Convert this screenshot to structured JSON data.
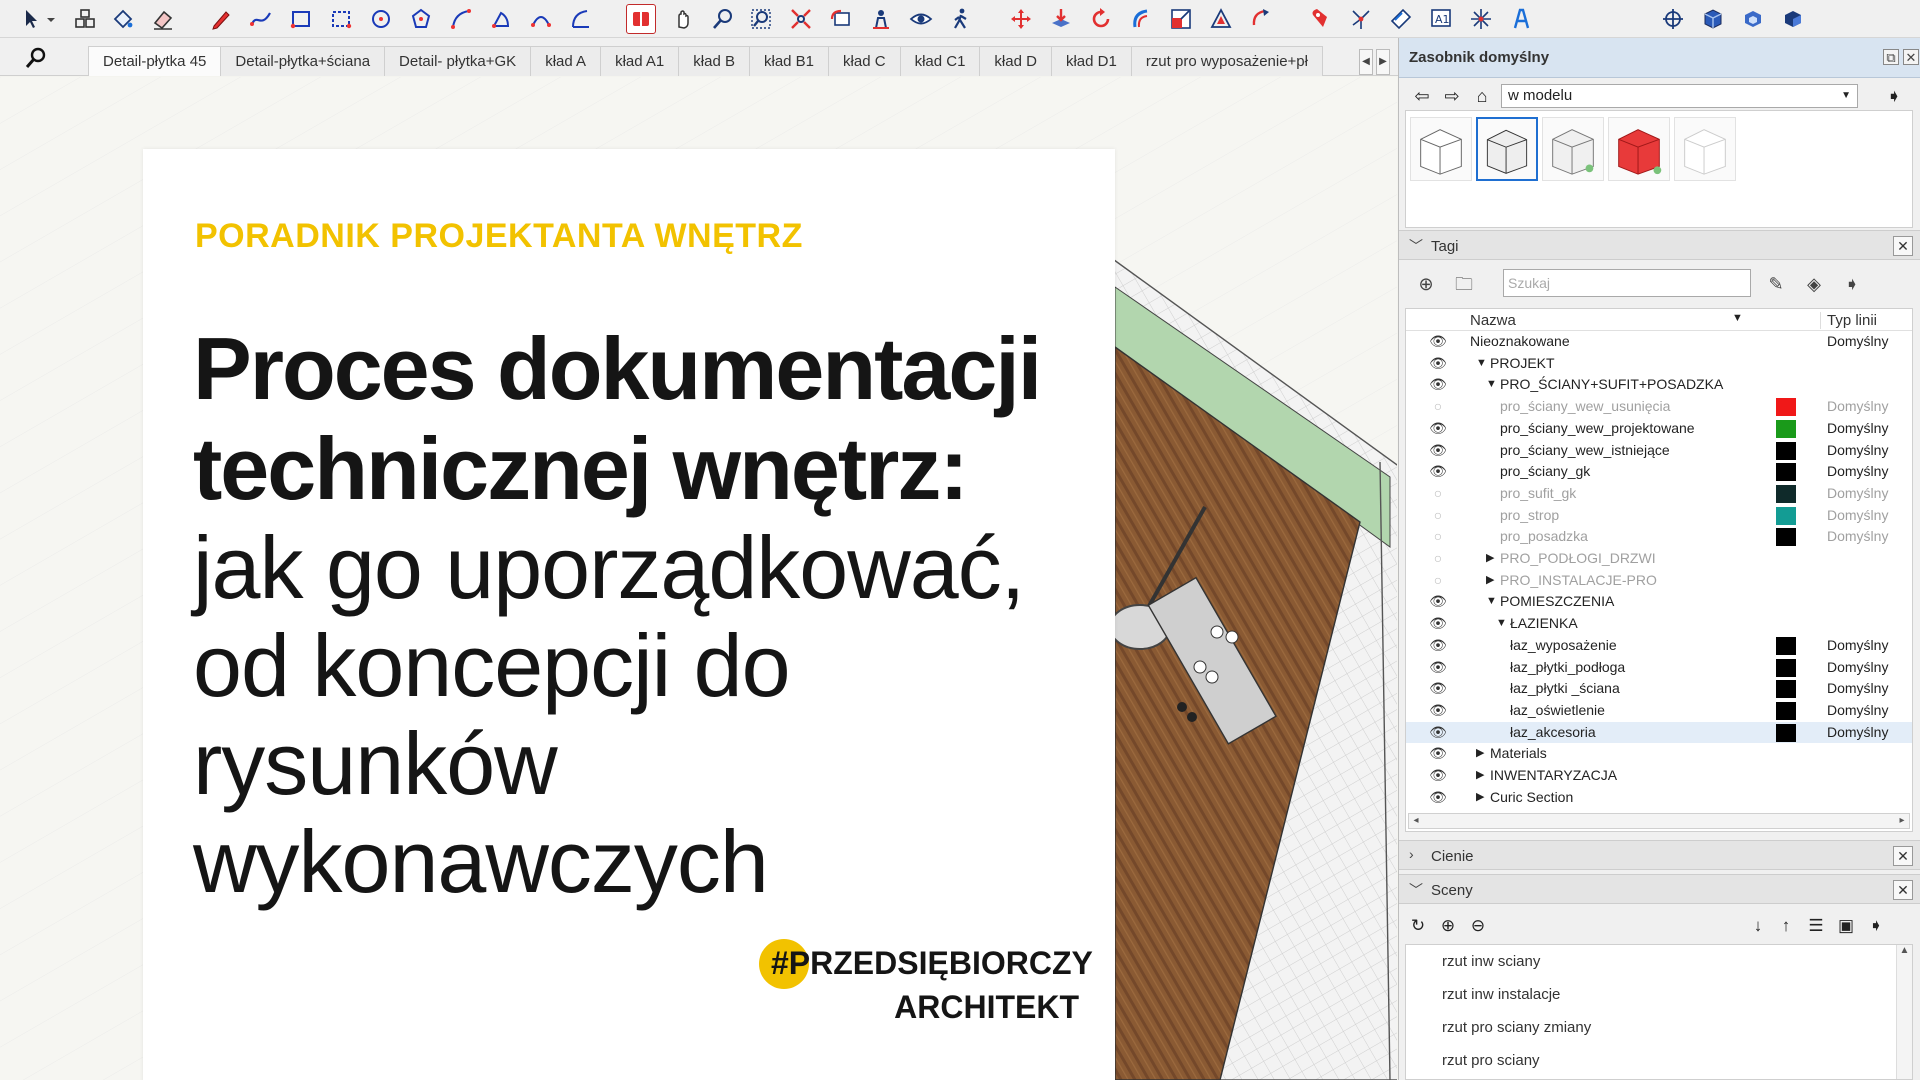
{
  "toolbar": {
    "tools": [
      "select-tool",
      "select-dropdown-icon",
      "component-icon",
      "paint-bucket-icon",
      "eraser-icon",
      "pencil-icon",
      "freehand-icon",
      "rectangle-icon",
      "rotated-rectangle-icon",
      "circle-icon",
      "polygon-icon",
      "arc-icon",
      "pie-icon",
      "two-point-arc-icon",
      "three-point-arc-icon",
      "section-plane-icon",
      "pan-icon",
      "zoom-icon",
      "zoom-window-icon",
      "zoom-extents-icon",
      "previous-view-icon",
      "position-camera-icon",
      "look-around-icon",
      "walk-icon",
      "move-icon",
      "push-pull-icon",
      "rotate-icon",
      "follow-me-icon",
      "scale-icon",
      "offset-icon",
      "tape-measure-icon",
      "protractor-icon",
      "axes-icon",
      "dimension-icon",
      "text-icon",
      "3d-text-icon",
      "section-fill-icon",
      "warehouse-icon",
      "extension-icon",
      "styles-icon",
      "layers-icon"
    ]
  },
  "tabs": {
    "items": [
      "Detail-płytka 45",
      "Detail-płytka+ściana",
      "Detail- płytka+GK",
      "kład A",
      "kład A1",
      "kład B",
      "kład B1",
      "kład C",
      "kład C1",
      "kład D",
      "kład D1",
      "rzut pro wyposażenie+pł"
    ],
    "active_index": 0
  },
  "card": {
    "kicker": "PORADNIK PROJEKTANTA WNĘTRZ",
    "headline_line1": "Proces dokumentacji",
    "headline_line2": "technicznej wnętrz:",
    "sub_line1": "jak go uporządkować,",
    "sub_line2": "od koncepcji do",
    "sub_line3": "rysunków",
    "sub_line4": "wykonawczych",
    "brand_line1": "#PRZEDSIĘBIORCZY",
    "brand_line2": "ARCHITEKT",
    "kicker_color": "#f2c200"
  },
  "panel": {
    "title": "Zasobnik domyślny",
    "model_select": "w modelu",
    "tags_label": "Tagi",
    "tags_search_placeholder": "Szukaj",
    "col_name": "Nazwa",
    "col_type": "Typ linii",
    "tags": [
      {
        "name": "Nieoznakowane",
        "visible": true,
        "indent": 0,
        "arrow": "",
        "color": "",
        "type": "Domyślny",
        "dim": false
      },
      {
        "name": "PROJEKT",
        "visible": true,
        "indent": 1,
        "arrow": "▼",
        "color": "",
        "type": "",
        "dim": false
      },
      {
        "name": "PRO_ŚCIANY+SUFIT+POSADZKA",
        "visible": true,
        "indent": 2,
        "arrow": "▼",
        "color": "",
        "type": "",
        "dim": false
      },
      {
        "name": "pro_ściany_wew_usunięcia",
        "visible": false,
        "indent": 3,
        "arrow": "",
        "color": "#f01818",
        "type": "Domyślny",
        "dim": true
      },
      {
        "name": "pro_ściany_wew_projektowane",
        "visible": true,
        "indent": 3,
        "arrow": "",
        "color": "#1a9a1a",
        "type": "Domyślny",
        "dim": false
      },
      {
        "name": "pro_ściany_wew_istniejące",
        "visible": true,
        "indent": 3,
        "arrow": "",
        "color": "#000000",
        "type": "Domyślny",
        "dim": false
      },
      {
        "name": "pro_ściany_gk",
        "visible": true,
        "indent": 3,
        "arrow": "",
        "color": "#000000",
        "type": "Domyślny",
        "dim": false
      },
      {
        "name": "pro_sufit_gk",
        "visible": false,
        "indent": 3,
        "arrow": "",
        "color": "#0f2a2a",
        "type": "Domyślny",
        "dim": true
      },
      {
        "name": "pro_strop",
        "visible": false,
        "indent": 3,
        "arrow": "",
        "color": "#139c94",
        "type": "Domyślny",
        "dim": true
      },
      {
        "name": "pro_posadzka",
        "visible": false,
        "indent": 3,
        "arrow": "",
        "color": "#000000",
        "type": "Domyślny",
        "dim": true
      },
      {
        "name": "PRO_PODŁOGI_DRZWI",
        "visible": false,
        "indent": 2,
        "arrow": "▶",
        "color": "",
        "type": "",
        "dim": true
      },
      {
        "name": "PRO_INSTALACJE-PRO",
        "visible": false,
        "indent": 2,
        "arrow": "▶",
        "color": "",
        "type": "",
        "dim": true
      },
      {
        "name": "POMIESZCZENIA",
        "visible": true,
        "indent": 2,
        "arrow": "▼",
        "color": "",
        "type": "",
        "dim": false
      },
      {
        "name": "ŁAZIENKA",
        "visible": true,
        "indent": 3,
        "arrow": "▼",
        "color": "",
        "type": "",
        "dim": false
      },
      {
        "name": "łaz_wyposażenie",
        "visible": true,
        "indent": 4,
        "arrow": "",
        "color": "#000000",
        "type": "Domyślny",
        "dim": false
      },
      {
        "name": "łaz_płytki_podłoga",
        "visible": true,
        "indent": 4,
        "arrow": "",
        "color": "#000000",
        "type": "Domyślny",
        "dim": false
      },
      {
        "name": "łaz_płytki _ściana",
        "visible": true,
        "indent": 4,
        "arrow": "",
        "color": "#000000",
        "type": "Domyślny",
        "dim": false
      },
      {
        "name": "łaz_oświetlenie",
        "visible": true,
        "indent": 4,
        "arrow": "",
        "color": "#000000",
        "type": "Domyślny",
        "dim": false
      },
      {
        "name": "łaz_akcesoria",
        "visible": true,
        "indent": 4,
        "arrow": "",
        "color": "#000000",
        "type": "Domyślny",
        "dim": false,
        "highlight": true
      },
      {
        "name": "Materials",
        "visible": true,
        "indent": 1,
        "arrow": "▶",
        "color": "",
        "type": "",
        "dim": false
      },
      {
        "name": "INWENTARYZACJA",
        "visible": true,
        "indent": 1,
        "arrow": "▶",
        "color": "",
        "type": "",
        "dim": false
      },
      {
        "name": "Curic Section",
        "visible": true,
        "indent": 1,
        "arrow": "▶",
        "color": "",
        "type": "",
        "dim": false
      }
    ],
    "shadows_label": "Cienie",
    "scenes_label": "Sceny",
    "scenes": [
      "rzut inw sciany",
      "rzut inw instalacje",
      "rzut pro sciany zmiany",
      "rzut pro sciany"
    ]
  }
}
